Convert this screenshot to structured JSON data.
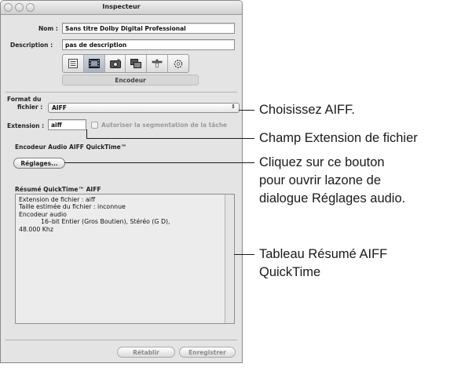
{
  "window": {
    "title": "Inspecteur",
    "name_label": "Nom :",
    "name_value": "Sans titre  Dolby Digital Professional",
    "description_label": "Description :",
    "description_value": "pas de description",
    "toolbar_icons": [
      "list-icon",
      "film-icon",
      "camera-icon",
      "layers-icon",
      "tools-icon",
      "gear-icon"
    ],
    "tab_label": "Encodeur"
  },
  "format": {
    "label_line1": "Format du",
    "label_line2": "fichier :",
    "value": "AIFF"
  },
  "extension": {
    "label": "Extension :",
    "value": "aiff",
    "checkbox_label": "Autoriser la segmentation de la tâche"
  },
  "encoder": {
    "section_title": "Encodeur Audio AIFF QuickTime™",
    "settings_button": "Réglages..."
  },
  "summary": {
    "title": "Résumé QuickTime™ AIFF",
    "lines": [
      "Extension de fichier : aiff",
      "Taille estimée du fichier : inconnue",
      "Encodeur audio",
      "16–bit Entier (Gros Boutien), Stéréo (G D),",
      "48.000 Khz"
    ]
  },
  "footer": {
    "revert_button": "Rétablir",
    "save_button": "Enregistrer"
  },
  "callouts": {
    "format": "Choisissez AIFF.",
    "extension": "Champ Extension de fichier",
    "settings_line1": "Cliquez sur ce bouton",
    "settings_line2": "pour ouvrir lazone de",
    "settings_line3": "dialogue Réglages audio.",
    "summary_line1": "Tableau Résumé AIFF",
    "summary_line2": "QuickTime"
  }
}
